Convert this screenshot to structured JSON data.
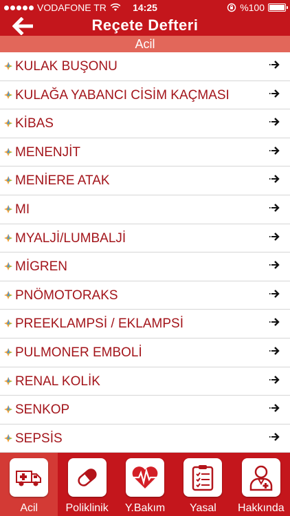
{
  "status": {
    "carrier": "VODAFONE TR",
    "time": "14:25",
    "battery": "%100",
    "battery_level": 1.0
  },
  "nav": {
    "title": "Reçete Defteri",
    "back_icon": "back-arrow-icon"
  },
  "section": {
    "title": "Acil"
  },
  "items": [
    {
      "label": "KULAK BUŞONU"
    },
    {
      "label": "KULAĞA YABANCI CİSİM KAÇMASI"
    },
    {
      "label": "KİBAS"
    },
    {
      "label": "MENENJİT"
    },
    {
      "label": "MENİERE ATAK"
    },
    {
      "label": "MI"
    },
    {
      "label": "MYALJİ/LUMBALJİ"
    },
    {
      "label": "MİGREN"
    },
    {
      "label": "PNÖMOTORAKS"
    },
    {
      "label": "PREEKLAMPSİ / EKLAMPSİ"
    },
    {
      "label": "PULMONER EMBOLİ"
    },
    {
      "label": "RENAL KOLİK"
    },
    {
      "label": "SENKOP"
    },
    {
      "label": "SEPSİS"
    }
  ],
  "tabs": [
    {
      "label": "Acil",
      "icon": "ambulance-icon",
      "active": true
    },
    {
      "label": "Poliklinik",
      "icon": "pill-icon",
      "active": false
    },
    {
      "label": "Y.Bakım",
      "icon": "heart-monitor-icon",
      "active": false
    },
    {
      "label": "Yasal",
      "icon": "clipboard-checklist-icon",
      "active": false
    },
    {
      "label": "Hakkında",
      "icon": "doctor-icon",
      "active": false
    }
  ],
  "colors": {
    "brand_red": "#c4161c",
    "section_bg": "#e2675a",
    "item_text": "#a3151b",
    "active_tab": "#d33a35"
  }
}
